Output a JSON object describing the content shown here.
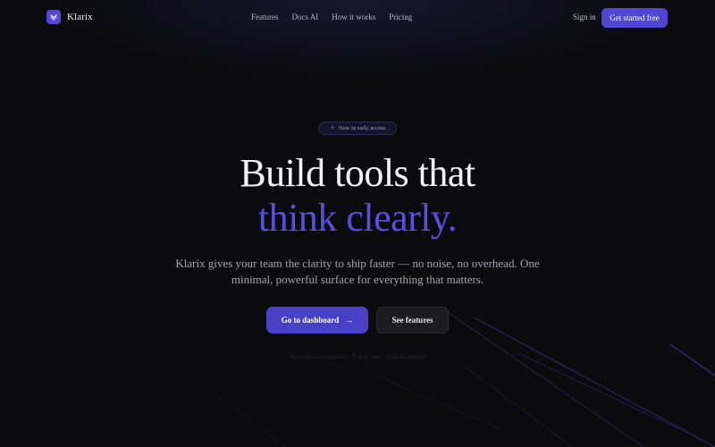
{
  "brand": {
    "name": "Klarix",
    "logo_icon": "chevron-down-icon",
    "accent_color": "#5046d6"
  },
  "nav": {
    "links": [
      "Features",
      "Docs AI",
      "How it works",
      "Pricing"
    ],
    "signin_label": "Sign in",
    "cta_label": "Get started free"
  },
  "hero": {
    "badge": {
      "icon": "sparkle-icon",
      "text": "Now in early access"
    },
    "headline_line1": "Build tools that",
    "headline_line2": "think clearly.",
    "subtext": "Klarix gives your team the clarity to ship faster — no noise, no overhead. One minimal, powerful surface for everything that matters.",
    "primary_button": "Go to dashboard",
    "primary_button_icon": "arrow-right-icon",
    "secondary_button": "See features",
    "footnote": "No credit card required · Free to start · Cancel anytime"
  }
}
